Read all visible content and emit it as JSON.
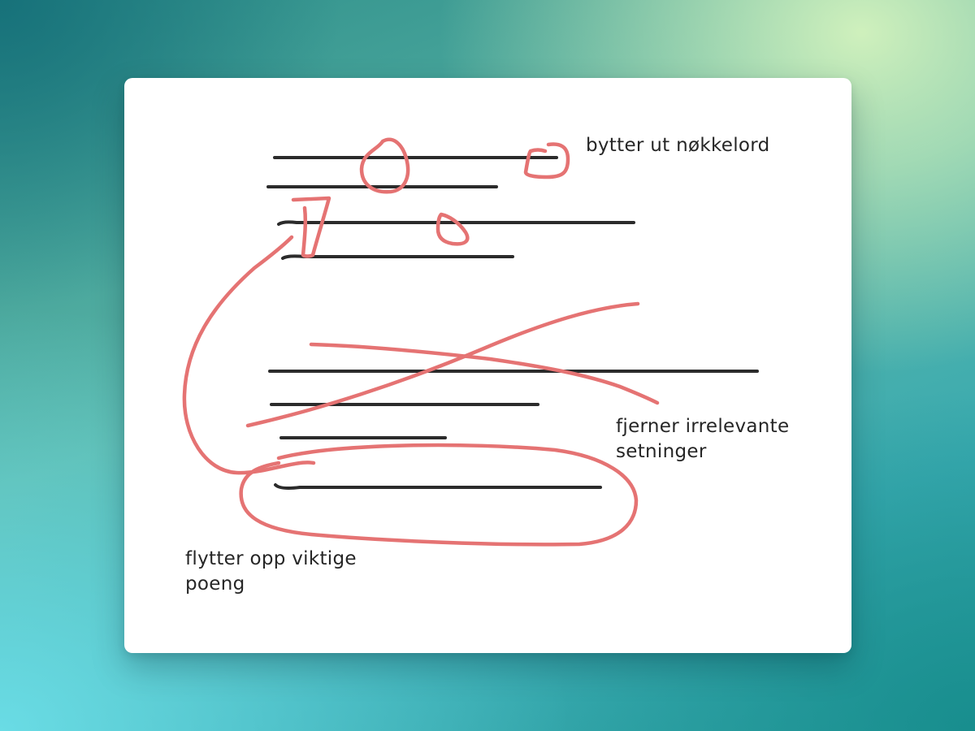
{
  "annotations": {
    "replace_keywords": {
      "lines": [
        "bytter ut nøkkelord"
      ]
    },
    "remove_irrelevant": {
      "lines": [
        "fjerner irrelevante",
        "setninger"
      ]
    },
    "move_up_points": {
      "lines": [
        "flytter opp viktige",
        "poeng"
      ]
    }
  },
  "colors": {
    "pen": "#e57373",
    "text_lines": "#2b2b2b",
    "card": "#ffffff"
  }
}
